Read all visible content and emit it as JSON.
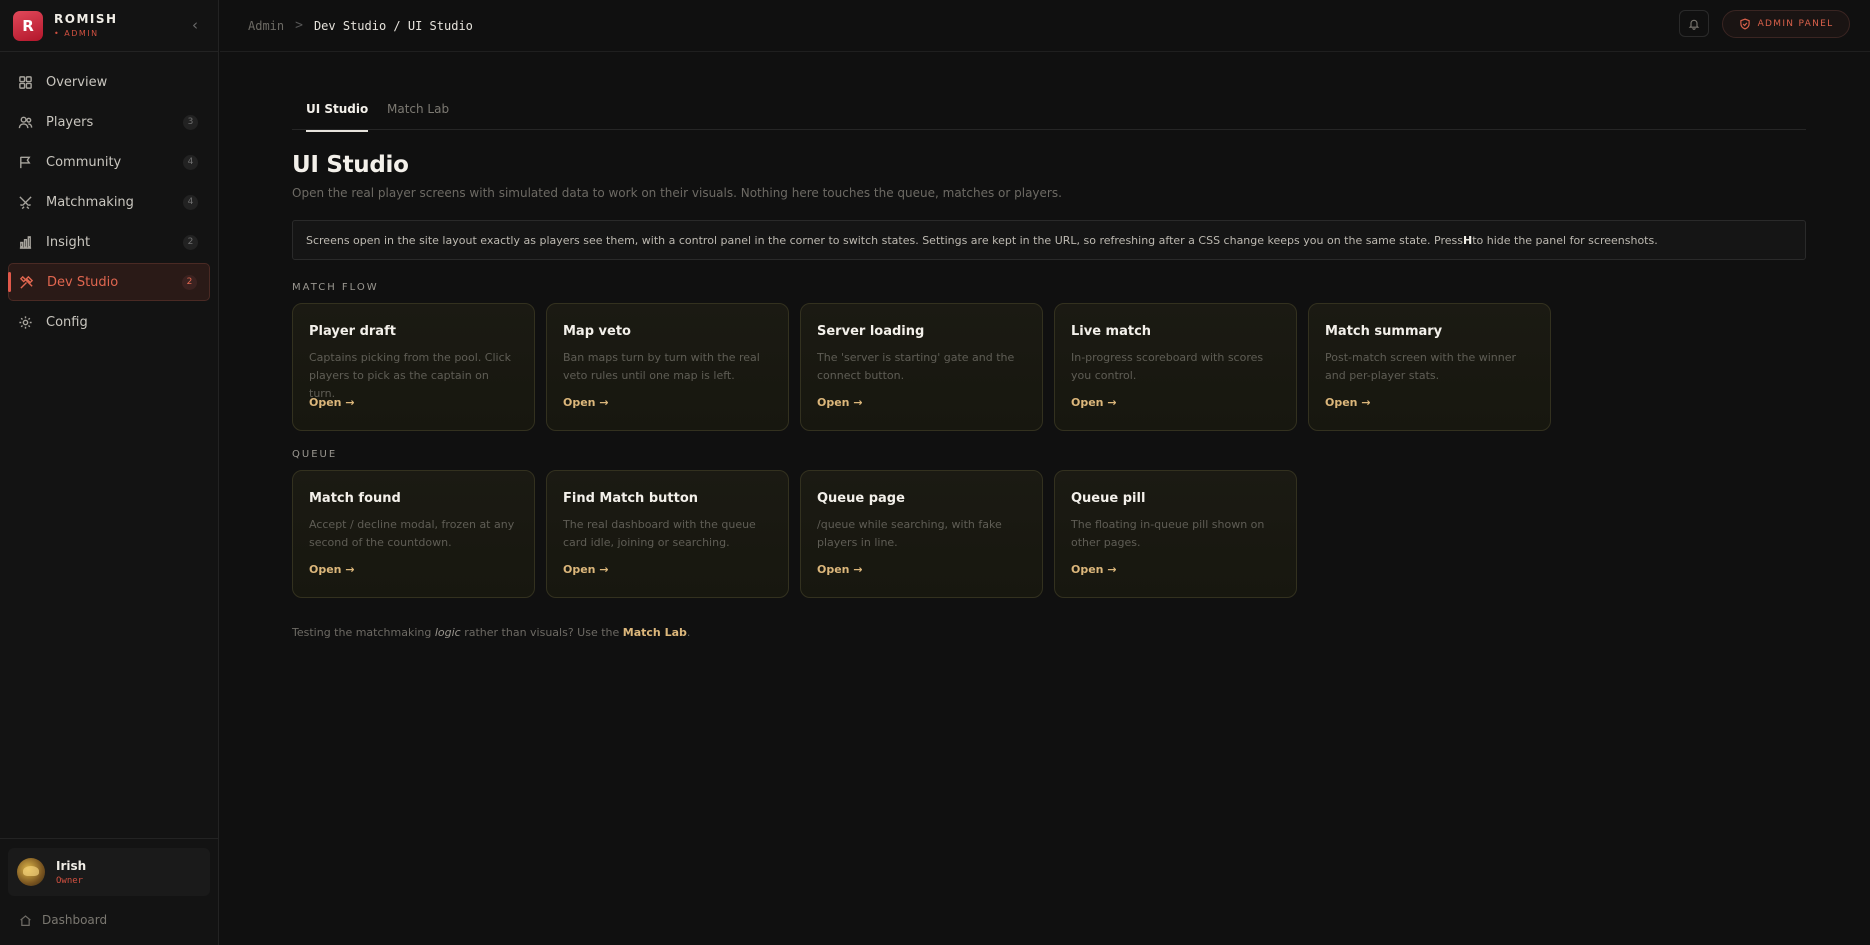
{
  "brand": {
    "logo_letter": "R",
    "name": "ROMISH",
    "sub": "• ADMIN"
  },
  "sidebar": {
    "items": [
      {
        "label": "Overview",
        "icon": "grid-icon",
        "badge": ""
      },
      {
        "label": "Players",
        "icon": "users-icon",
        "badge": "3"
      },
      {
        "label": "Community",
        "icon": "flag-icon",
        "badge": "4"
      },
      {
        "label": "Matchmaking",
        "icon": "swords-icon",
        "badge": "4"
      },
      {
        "label": "Insight",
        "icon": "bar-chart-icon",
        "badge": "2"
      },
      {
        "label": "Dev Studio",
        "icon": "tools-icon",
        "badge": "2",
        "active": true
      },
      {
        "label": "Config",
        "icon": "gear-icon",
        "badge": ""
      }
    ]
  },
  "user": {
    "name": "Irish",
    "role": "Owner"
  },
  "dashboard_link": "Dashboard",
  "breadcrumb": {
    "root": "Admin",
    "separator": ">",
    "current": "Dev Studio / UI Studio"
  },
  "header": {
    "admin_panel": "ADMIN PANEL"
  },
  "tabs": [
    {
      "label": "UI Studio",
      "active": true
    },
    {
      "label": "Match Lab"
    }
  ],
  "page": {
    "title": "UI Studio",
    "subtitle": "Open the real player screens with simulated data to work on their visuals. Nothing here touches the queue, matches or players.",
    "note_before": "Screens open in the site layout exactly as players see them, with a control panel in the corner to switch states. Settings are kept in the URL, so refreshing after a CSS change keeps you on the same state. Press ",
    "note_key": "H",
    "note_after": " to hide the panel for screenshots."
  },
  "sections": [
    {
      "title": "MATCH FLOW",
      "cards": [
        {
          "title": "Player draft",
          "desc": "Captains picking from the pool. Click players to pick as the captain on turn.",
          "open": "Open →"
        },
        {
          "title": "Map veto",
          "desc": "Ban maps turn by turn with the real veto rules until one map is left.",
          "open": "Open →"
        },
        {
          "title": "Server loading",
          "desc": "The 'server is starting' gate and the connect button.",
          "open": "Open →"
        },
        {
          "title": "Live match",
          "desc": "In-progress scoreboard with scores you control.",
          "open": "Open →"
        },
        {
          "title": "Match summary",
          "desc": "Post-match screen with the winner and per-player stats.",
          "open": "Open →"
        }
      ]
    },
    {
      "title": "QUEUE",
      "cards": [
        {
          "title": "Match found",
          "desc": "Accept / decline modal, frozen at any second of the countdown.",
          "open": "Open →"
        },
        {
          "title": "Find Match button",
          "desc": "The real dashboard with the queue card idle, joining or searching.",
          "open": "Open →"
        },
        {
          "title": "Queue page",
          "desc": "/queue while searching, with fake players in line.",
          "open": "Open →"
        },
        {
          "title": "Queue pill",
          "desc": "The floating in-queue pill shown on other pages.",
          "open": "Open →"
        }
      ]
    }
  ],
  "footer": {
    "before": "Testing the matchmaking ",
    "em": "logic",
    "middle": " rather than visuals? Use the ",
    "link": "Match Lab",
    "after": "."
  },
  "colors": {
    "accent": "#e0584a",
    "card_link": "#dcb77b",
    "background": "#101010"
  }
}
